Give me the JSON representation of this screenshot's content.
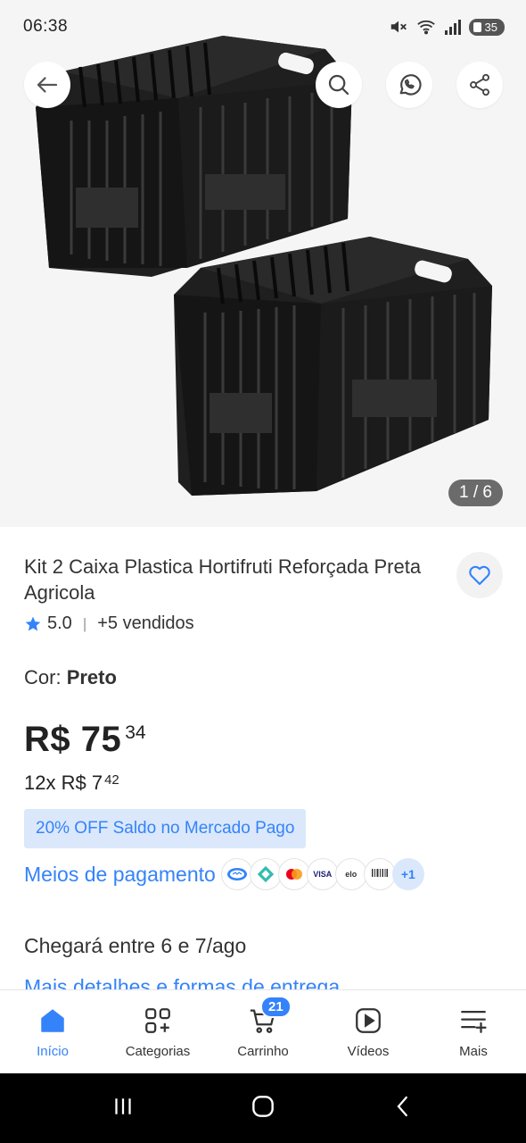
{
  "status_bar": {
    "time": "06:38",
    "battery": "35"
  },
  "gallery": {
    "counter": "1 / 6"
  },
  "product": {
    "title": "Kit 2 Caixa Plastica Hortifruti Reforçada Preta Agricola",
    "rating": "5.0",
    "sold": "+5 vendidos",
    "color_label": "Cor: ",
    "color_value": "Preto",
    "price_main": "R$ 75",
    "price_cents": "34",
    "installments_text": "12x R$ 7",
    "installments_cents": "42",
    "discount": "20% OFF Saldo no Mercado Pago",
    "payment_link": "Meios de pagamento",
    "payment_more": "+1",
    "delivery": "Chegará entre 6 e 7/ago",
    "delivery_link": "Mais detalhes e formas de entrega"
  },
  "colors": {
    "accent": "#3483fa",
    "accent_light": "#dbe8fb"
  },
  "bottom_nav": {
    "items": [
      {
        "label": "Início",
        "icon": "home-icon"
      },
      {
        "label": "Categorias",
        "icon": "categories-icon"
      },
      {
        "label": "Carrinho",
        "icon": "cart-icon"
      },
      {
        "label": "Vídeos",
        "icon": "video-icon"
      },
      {
        "label": "Mais",
        "icon": "menu-icon"
      }
    ],
    "cart_count": "21"
  }
}
